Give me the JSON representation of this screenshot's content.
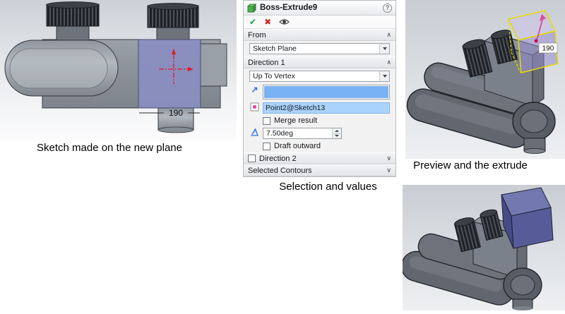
{
  "captions": {
    "left": "Sketch made on the new plane",
    "middle": "Selection and values",
    "right_top": "Preview and the extrude"
  },
  "panel": {
    "title": "Boss-Extrude9",
    "from": {
      "header": "From",
      "value": "Sketch Plane"
    },
    "direction1": {
      "header": "Direction 1",
      "end_condition": "Up To Vertex",
      "vertex": "Point2@Sketch13",
      "merge_result": "Merge result",
      "draft_angle": "7.50deg",
      "draft_outward": "Draft outward"
    },
    "direction2": {
      "header": "Direction 2"
    },
    "selected_contours": {
      "header": "Selected Contours"
    }
  },
  "icons": {
    "help": "?",
    "ok": "✔",
    "cancel": "✖",
    "chevron_up": "∧",
    "chevron_down": "∨",
    "arrow_up_right": "↗"
  },
  "dimensions": {
    "sketch": "190",
    "preview": "190"
  },
  "colors": {
    "selection_highlight": "#a9d3fb",
    "active_selection_bar": "#79b2f2",
    "preview_wireframe": "#e4dc00",
    "sketch_face": "#8a8ec1",
    "extrude_face": "#575c99"
  }
}
